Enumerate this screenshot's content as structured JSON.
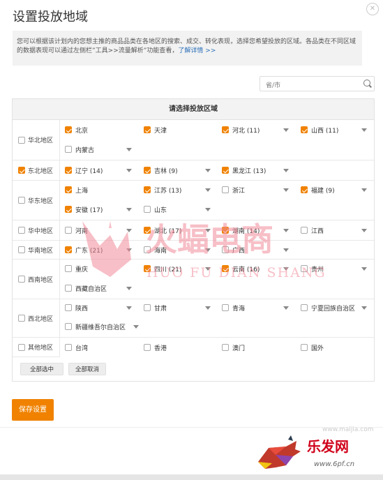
{
  "dialog": {
    "title": "设置投放地域",
    "close_icon": "close-icon",
    "notice_text": "您可以根据该计划内的您想主推的商品品类在各地区的搜索、成交、转化表现，选择您希望投放的区域。各品类在不同区域的数据表现可以通过左侧栏”工具>>流量解析”功能查看，",
    "notice_link": "了解详情 >>",
    "search": {
      "placeholder": "省/市",
      "icon": "search-icon"
    },
    "table_title": "请选择投放区域",
    "select_all": "全部选中",
    "deselect_all": "全部取消",
    "save": "保存设置",
    "accent_color": "#f08200"
  },
  "rows": [
    {
      "region": "华北地区",
      "checked": false,
      "provinces": [
        {
          "name": "北京",
          "checked": true,
          "dropdown": false
        },
        {
          "name": "天津",
          "checked": true,
          "dropdown": false
        },
        {
          "name": "河北 (11)",
          "checked": true,
          "dropdown": true
        },
        {
          "name": "山西 (11)",
          "checked": true,
          "dropdown": true
        },
        {
          "name": "内蒙古",
          "checked": false,
          "dropdown": true
        }
      ]
    },
    {
      "region": "东北地区",
      "checked": true,
      "provinces": [
        {
          "name": "辽宁 (14)",
          "checked": true,
          "dropdown": true
        },
        {
          "name": "吉林 (9)",
          "checked": true,
          "dropdown": true
        },
        {
          "name": "黑龙江 (13)",
          "checked": true,
          "dropdown": true
        }
      ]
    },
    {
      "region": "华东地区",
      "checked": false,
      "provinces": [
        {
          "name": "上海",
          "checked": true,
          "dropdown": false
        },
        {
          "name": "江苏 (13)",
          "checked": true,
          "dropdown": true
        },
        {
          "name": "浙江",
          "checked": false,
          "dropdown": true
        },
        {
          "name": "福建 (9)",
          "checked": true,
          "dropdown": true
        },
        {
          "name": "安徽 (17)",
          "checked": true,
          "dropdown": true
        },
        {
          "name": "山东",
          "checked": false,
          "dropdown": true
        }
      ]
    },
    {
      "region": "华中地区",
      "checked": false,
      "provinces": [
        {
          "name": "河南",
          "checked": false,
          "dropdown": true
        },
        {
          "name": "湖北 (17)",
          "checked": true,
          "dropdown": true
        },
        {
          "name": "湖南 (14)",
          "checked": true,
          "dropdown": true
        },
        {
          "name": "江西",
          "checked": false,
          "dropdown": true
        }
      ]
    },
    {
      "region": "华南地区",
      "checked": false,
      "provinces": [
        {
          "name": "广东 (21)",
          "checked": true,
          "dropdown": true
        },
        {
          "name": "海南",
          "checked": false,
          "dropdown": true
        },
        {
          "name": "广西",
          "checked": false,
          "dropdown": true
        }
      ]
    },
    {
      "region": "西南地区",
      "checked": false,
      "provinces": [
        {
          "name": "重庆",
          "checked": false,
          "dropdown": false
        },
        {
          "name": "四川 (21)",
          "checked": true,
          "dropdown": true
        },
        {
          "name": "云南 (16)",
          "checked": true,
          "dropdown": true
        },
        {
          "name": "贵州",
          "checked": false,
          "dropdown": true
        },
        {
          "name": "西藏自治区",
          "checked": false,
          "dropdown": true
        }
      ]
    },
    {
      "region": "西北地区",
      "checked": false,
      "provinces": [
        {
          "name": "陕西",
          "checked": false,
          "dropdown": true
        },
        {
          "name": "甘肃",
          "checked": false,
          "dropdown": true
        },
        {
          "name": "青海",
          "checked": false,
          "dropdown": true
        },
        {
          "name": "宁夏回族自治区",
          "checked": false,
          "dropdown": true
        },
        {
          "name": "新疆维吾尔自治区",
          "checked": false,
          "dropdown": true
        }
      ]
    },
    {
      "region": "其他地区",
      "checked": false,
      "provinces": [
        {
          "name": "台湾",
          "checked": false,
          "dropdown": false
        },
        {
          "name": "香港",
          "checked": false,
          "dropdown": false
        },
        {
          "name": "澳门",
          "checked": false,
          "dropdown": false
        },
        {
          "name": "国外",
          "checked": false,
          "dropdown": false
        }
      ]
    }
  ],
  "watermark": {
    "brand_cn": "火蝠电商",
    "brand_en": "HUO FU DIAN SHANG",
    "logo_icon": "bat-logo-icon",
    "site_1": "www.maijia.com",
    "site_2": "www.6pf.cn",
    "site_3": "乐发网"
  }
}
